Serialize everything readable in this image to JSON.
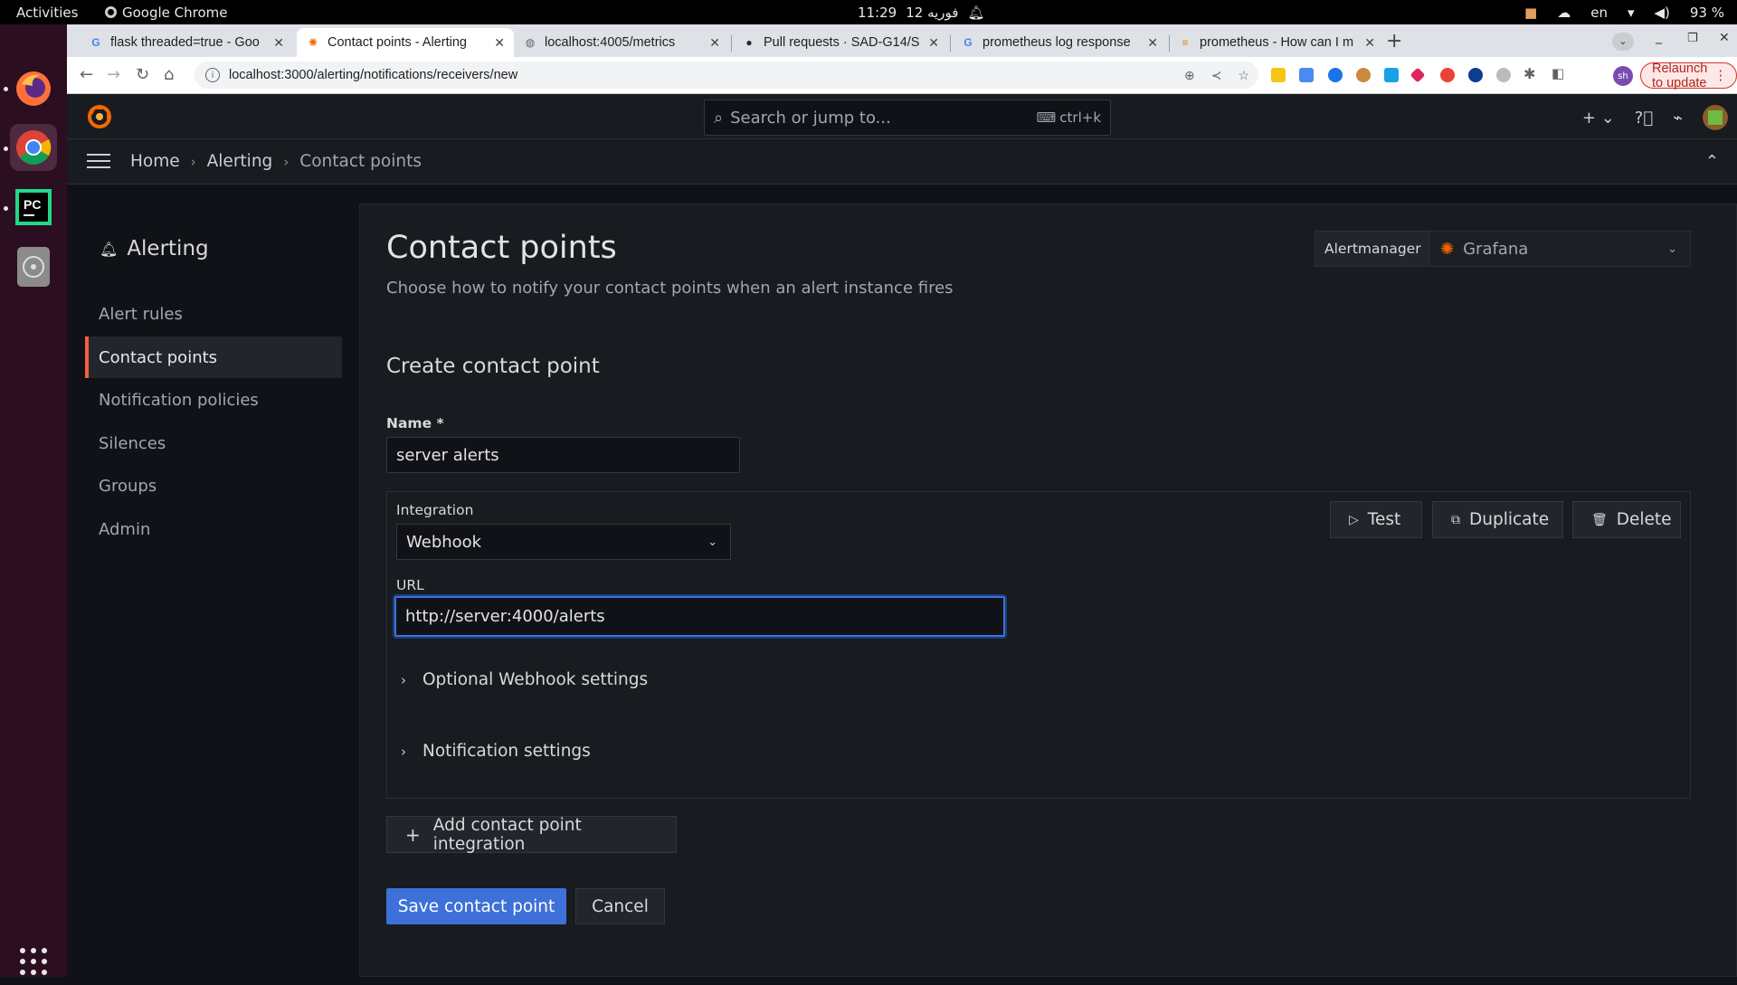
{
  "os": {
    "activities": "Activities",
    "app_name": "Google Chrome",
    "clock": "11:29",
    "date": "12 فوريه",
    "lang": "en",
    "battery": "93 %"
  },
  "chrome": {
    "tabs": [
      {
        "title": "flask threaded=true - Goo",
        "active": false
      },
      {
        "title": "Contact points - Alerting",
        "active": true
      },
      {
        "title": "localhost:4005/metrics",
        "active": false
      },
      {
        "title": "Pull requests · SAD-G14/S",
        "active": false
      },
      {
        "title": "prometheus log response",
        "active": false
      },
      {
        "title": "prometheus - How can I m",
        "active": false
      }
    ],
    "url": "localhost:3000/alerting/notifications/receivers/new",
    "relaunch": "Relaunch to update",
    "profile_initials": "sh"
  },
  "grafana": {
    "search_placeholder": "Search or jump to...",
    "search_shortcut": "ctrl+k",
    "breadcrumbs": [
      "Home",
      "Alerting",
      "Contact points"
    ],
    "sidebar": {
      "title": "Alerting",
      "items": [
        {
          "label": "Alert rules",
          "active": false
        },
        {
          "label": "Contact points",
          "active": true
        },
        {
          "label": "Notification policies",
          "active": false
        },
        {
          "label": "Silences",
          "active": false
        },
        {
          "label": "Groups",
          "active": false
        },
        {
          "label": "Admin",
          "active": false
        }
      ]
    },
    "page": {
      "title": "Contact points",
      "subtitle": "Choose how to notify your contact points when an alert instance fires",
      "alertmanager_label": "Alertmanager",
      "alertmanager_value": "Grafana",
      "section_title": "Create contact point",
      "name_label": "Name *",
      "name_value": "server alerts",
      "integration_label": "Integration",
      "integration_value": "Webhook",
      "url_label": "URL",
      "url_value": "http://server:4000/alerts",
      "test_button": "Test",
      "duplicate_button": "Duplicate",
      "delete_button": "Delete",
      "optional_settings": "Optional Webhook settings",
      "notification_settings": "Notification settings",
      "add_integration": "Add contact point integration",
      "save_button": "Save contact point",
      "cancel_button": "Cancel"
    }
  }
}
